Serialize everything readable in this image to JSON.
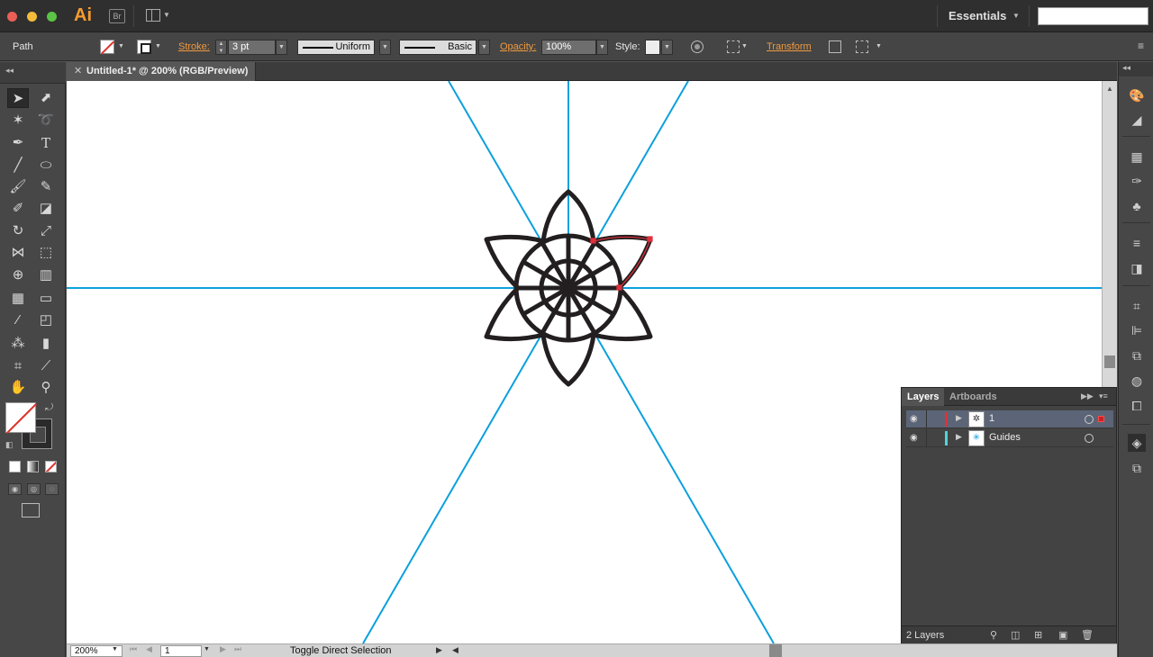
{
  "app": {
    "logo": "Ai",
    "bridge": "Br",
    "workspace": "Essentials",
    "search_placeholder": ""
  },
  "control_bar": {
    "selection_type": "Path",
    "stroke_label": "Stroke:",
    "stroke_weight": "3 pt",
    "variable_width": "Uniform",
    "brush": "Basic",
    "opacity_label": "Opacity:",
    "opacity_value": "100%",
    "style_label": "Style:",
    "transform_label": "Transform"
  },
  "document": {
    "tab_title": "Untitled-1* @ 200% (RGB/Preview)",
    "guide_color": "#0ca0dd",
    "artwork_color": "#231f20",
    "selection_color": "#e0303a"
  },
  "status_bar": {
    "zoom": "200%",
    "artboard_number": "1",
    "status_text": "Toggle Direct Selection"
  },
  "layers_panel": {
    "tabs": [
      "Layers",
      "Artboards"
    ],
    "layers": [
      {
        "name": "1",
        "color": "#e0303a",
        "selected": true
      },
      {
        "name": "Guides",
        "color": "#4fd3d8",
        "selected": false
      }
    ],
    "count_label": "2 Layers"
  },
  "icons": {
    "tools": [
      "selection-tool-icon",
      "direct-selection-tool-icon",
      "magic-wand-tool-icon",
      "lasso-tool-icon",
      "pen-tool-icon",
      "type-tool-icon",
      "line-segment-tool-icon",
      "ellipse-tool-icon",
      "paintbrush-tool-icon",
      "pencil-tool-icon",
      "blob-brush-tool-icon",
      "eraser-tool-icon",
      "rotate-tool-icon",
      "scale-tool-icon",
      "width-tool-icon",
      "free-transform-tool-icon",
      "shape-builder-tool-icon",
      "perspective-grid-tool-icon",
      "mesh-tool-icon",
      "gradient-tool-icon",
      "eyedropper-tool-icon",
      "blend-tool-icon",
      "symbol-sprayer-tool-icon",
      "column-graph-tool-icon",
      "artboard-tool-icon",
      "slice-tool-icon",
      "hand-tool-icon",
      "zoom-tool-icon"
    ]
  }
}
